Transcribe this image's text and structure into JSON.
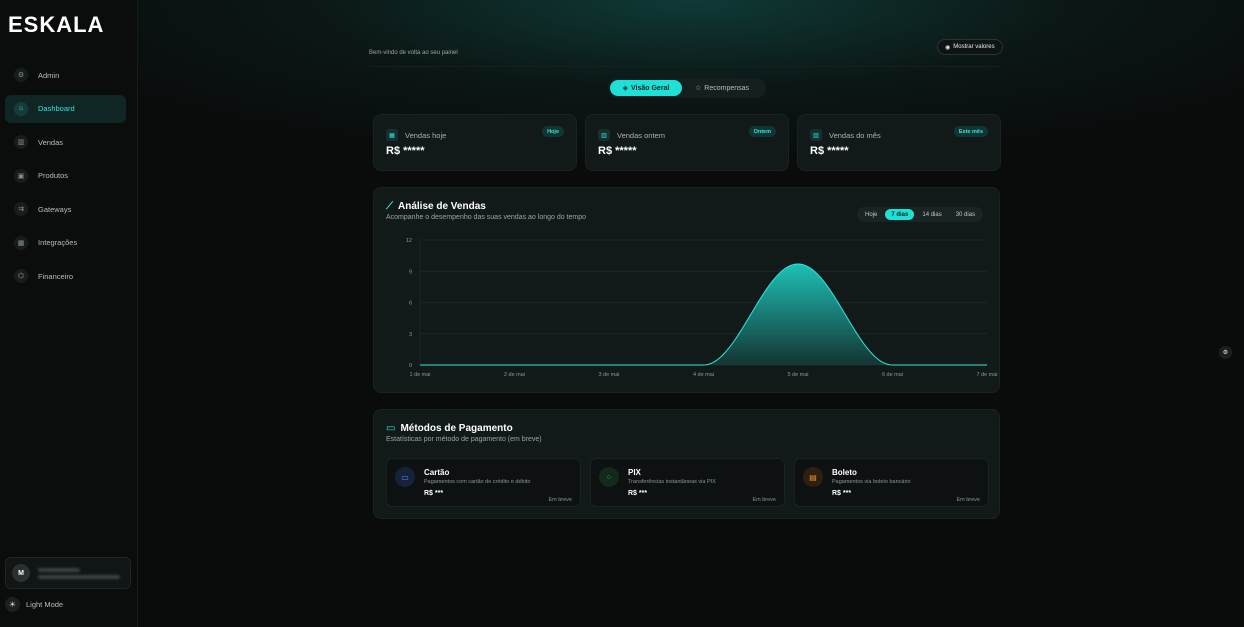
{
  "brand": {
    "logo": "ESKALA"
  },
  "sidebar": {
    "items": [
      {
        "label": "Admin",
        "icon": "⚙"
      },
      {
        "label": "Dashboard",
        "icon": "⌂"
      },
      {
        "label": "Vendas",
        "icon": "▥"
      },
      {
        "label": "Produtos",
        "icon": "▣"
      },
      {
        "label": "Gateways",
        "icon": "⇉"
      },
      {
        "label": "Integrações",
        "icon": "▦"
      },
      {
        "label": "Financeiro",
        "icon": "⌬"
      }
    ],
    "user_initial": "M",
    "light_mode_label": "Light Mode"
  },
  "header": {
    "welcome": "Bem-vindo de volta ao seu painel",
    "show_values": "Mostrar valores"
  },
  "tabs": {
    "overview": "Visão Geral",
    "rewards": "Recompensas"
  },
  "stats": [
    {
      "title": "Vendas hoje",
      "badge": "Hoje",
      "value": "R$ *****"
    },
    {
      "title": "Vendas ontem",
      "badge": "Ontem",
      "value": "R$ *****"
    },
    {
      "title": "Vendas do mês",
      "badge": "Este mês",
      "value": "R$ *****"
    }
  ],
  "chart": {
    "title": "Análise de Vendas",
    "subtitle": "Acompanhe o desempenho das suas vendas ao longo do tempo",
    "ranges": [
      "Hoje",
      "7 dias",
      "14 dias",
      "30 dias"
    ]
  },
  "chart_data": {
    "type": "area",
    "categories": [
      "1 de mai",
      "2 de mai",
      "3 de mai",
      "4 de mai",
      "5 de mai",
      "6 de mai",
      "7 de mai"
    ],
    "values": [
      0,
      0,
      0,
      0,
      9.7,
      0,
      0
    ],
    "yticks": [
      0,
      3,
      6,
      9,
      12
    ],
    "ylim": [
      0,
      12
    ],
    "grid": true,
    "color": "#1ec9bf"
  },
  "payments": {
    "title": "Métodos de Pagamento",
    "subtitle": "Estatísticas por método de pagamento (em breve)",
    "methods": [
      {
        "name": "Cartão",
        "desc": "Pagamentos com cartão de crédito e débito",
        "value": "R$ ***",
        "status": "Em breve",
        "icon": "▭",
        "color": "#4a7bd6"
      },
      {
        "name": "PIX",
        "desc": "Transferências instantâneas via PIX",
        "value": "R$ ***",
        "status": "Em breve",
        "icon": "⁘",
        "color": "#2fbf6a"
      },
      {
        "name": "Boleto",
        "desc": "Pagamentos via boleto bancário",
        "value": "R$ ***",
        "status": "Em breve",
        "icon": "▤",
        "color": "#e08a2a"
      }
    ]
  }
}
